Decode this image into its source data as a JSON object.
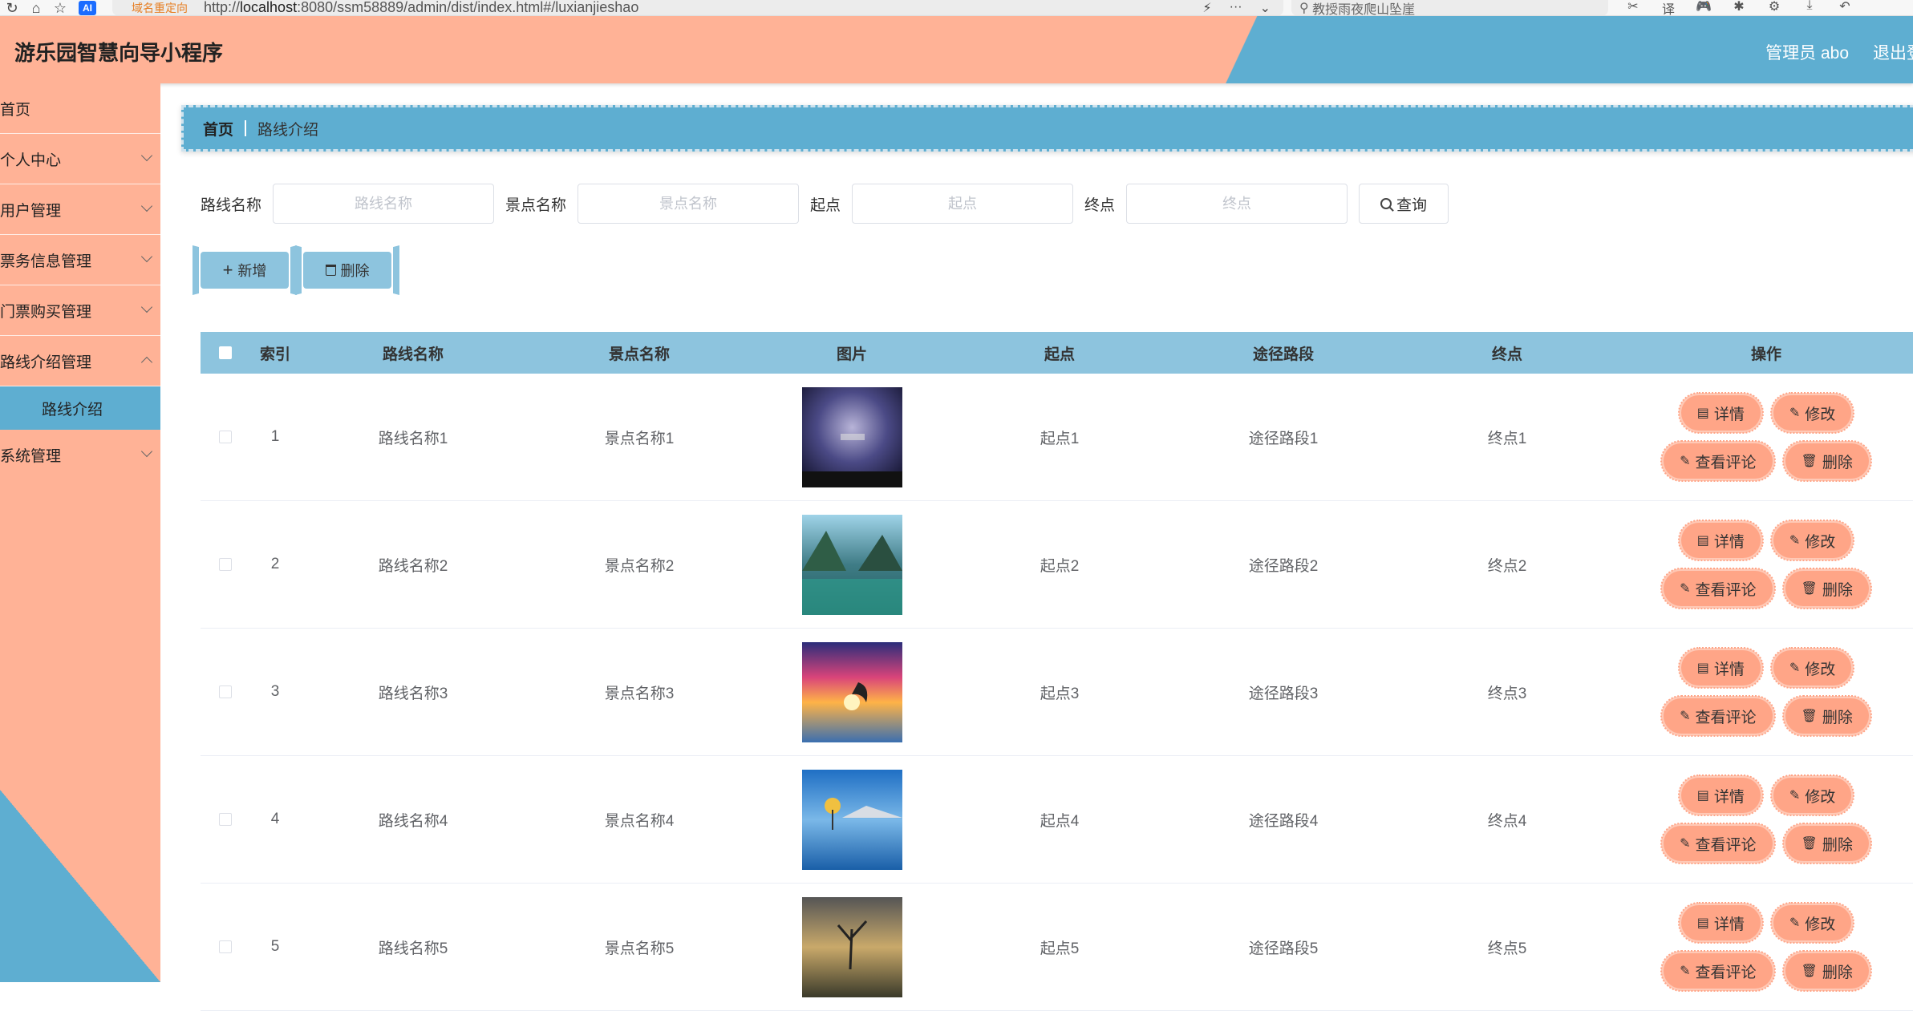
{
  "browser": {
    "redirect_label": "域名重定向",
    "url_prefix": "http://",
    "url_host": "localhost",
    "url_rest": ":8080/ssm58889/admin/dist/index.html#/luxianjieshao",
    "search_text": "教授雨夜爬山坠崖"
  },
  "header": {
    "title": "游乐园智慧向导小程序",
    "user_label": "管理员 abo",
    "logout_label": "退出登录"
  },
  "sidebar": {
    "items": [
      {
        "label": "首页",
        "has_children": false
      },
      {
        "label": "个人中心",
        "has_children": true
      },
      {
        "label": "用户管理",
        "has_children": true
      },
      {
        "label": "票务信息管理",
        "has_children": true
      },
      {
        "label": "门票购买管理",
        "has_children": true
      },
      {
        "label": "路线介绍管理",
        "has_children": true
      }
    ],
    "active_sub": "路线介绍",
    "last_item": "系统管理"
  },
  "breadcrumb": {
    "home": "首页",
    "current": "路线介绍"
  },
  "search": {
    "route_label": "路线名称",
    "route_placeholder": "路线名称",
    "spot_label": "景点名称",
    "spot_placeholder": "景点名称",
    "start_label": "起点",
    "start_placeholder": "起点",
    "end_label": "终点",
    "end_placeholder": "终点",
    "query_label": "查询"
  },
  "actions": {
    "add_label": "新增",
    "delete_label": "删除"
  },
  "table": {
    "headers": {
      "index": "索引",
      "route": "路线名称",
      "spot": "景点名称",
      "image": "图片",
      "start": "起点",
      "path": "途径路段",
      "end": "终点",
      "ops": "操作"
    },
    "rows": [
      {
        "index": "1",
        "route": "路线名称1",
        "spot": "景点名称1",
        "start": "起点1",
        "path": "途径路段1",
        "end": "终点1",
        "image_desc": "night-sky"
      },
      {
        "index": "2",
        "route": "路线名称2",
        "spot": "景点名称2",
        "start": "起点2",
        "path": "途径路段2",
        "end": "终点2",
        "image_desc": "lake-mountains"
      },
      {
        "index": "3",
        "route": "路线名称3",
        "spot": "景点名称3",
        "start": "起点3",
        "path": "途径路段3",
        "end": "终点3",
        "image_desc": "sunset-dolphin"
      },
      {
        "index": "4",
        "route": "路线名称4",
        "spot": "景点名称4",
        "start": "起点4",
        "path": "途径路段4",
        "end": "终点4",
        "image_desc": "lake-tree"
      },
      {
        "index": "5",
        "route": "路线名称5",
        "spot": "景点名称5",
        "start": "起点5",
        "path": "途径路段5",
        "end": "终点5",
        "image_desc": "dusk-tree"
      }
    ],
    "op_labels": {
      "detail": "详情",
      "edit": "修改",
      "comment": "查看评论",
      "delete": "删除"
    }
  },
  "colors": {
    "peach": "#ffb296",
    "blue": "#5eaed1",
    "light_blue": "#8dc4de",
    "op_button": "#ffa587"
  }
}
